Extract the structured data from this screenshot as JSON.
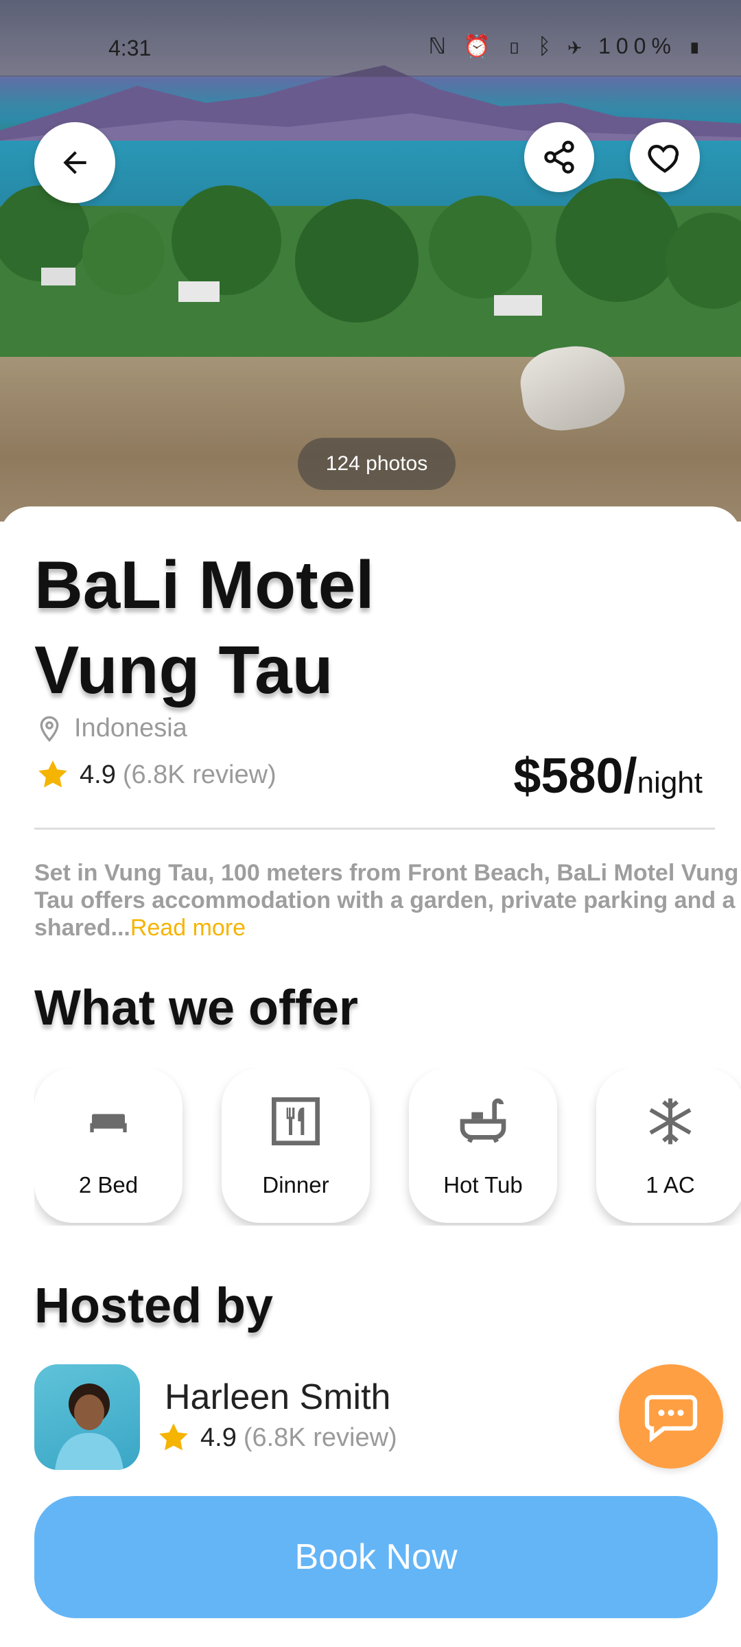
{
  "status_bar": {
    "time": "4:31",
    "battery": "100%",
    "icons": [
      "nfc-icon",
      "alarm-icon",
      "vibrate-icon",
      "bluetooth-icon",
      "airplane-icon",
      "battery-icon"
    ]
  },
  "hero": {
    "photos_label": "124 photos",
    "back_icon": "arrow-left-icon",
    "share_icon": "share-icon",
    "favorite_icon": "heart-outline-icon"
  },
  "listing": {
    "title_line1": "BaLi Motel",
    "title_line2": "Vung Tau",
    "location": "Indonesia",
    "rating": "4.9",
    "reviews": "(6.8K review)",
    "price": "$580/",
    "price_unit": "night",
    "description": "Set in Vung Tau, 100 meters from Front Beach, BaLi Motel Vung Tau offers accommodation with a garden, private parking and a shared...",
    "read_more": "Read more"
  },
  "offers": {
    "title": "What we offer",
    "items": [
      {
        "label": "2 Bed",
        "icon": "bed-icon"
      },
      {
        "label": "Dinner",
        "icon": "restaurant-icon"
      },
      {
        "label": "Hot Tub",
        "icon": "bathtub-icon"
      },
      {
        "label": "1 AC",
        "icon": "snowflake-icon"
      }
    ]
  },
  "host": {
    "title": "Hosted by",
    "name": "Harleen Smith",
    "rating": "4.9",
    "reviews": "(6.8K review)"
  },
  "cta": {
    "book_label": "Book Now"
  },
  "colors": {
    "accent_yellow": "#f5b400",
    "chat_orange": "#ff9f43",
    "book_blue": "#64b5f6"
  }
}
